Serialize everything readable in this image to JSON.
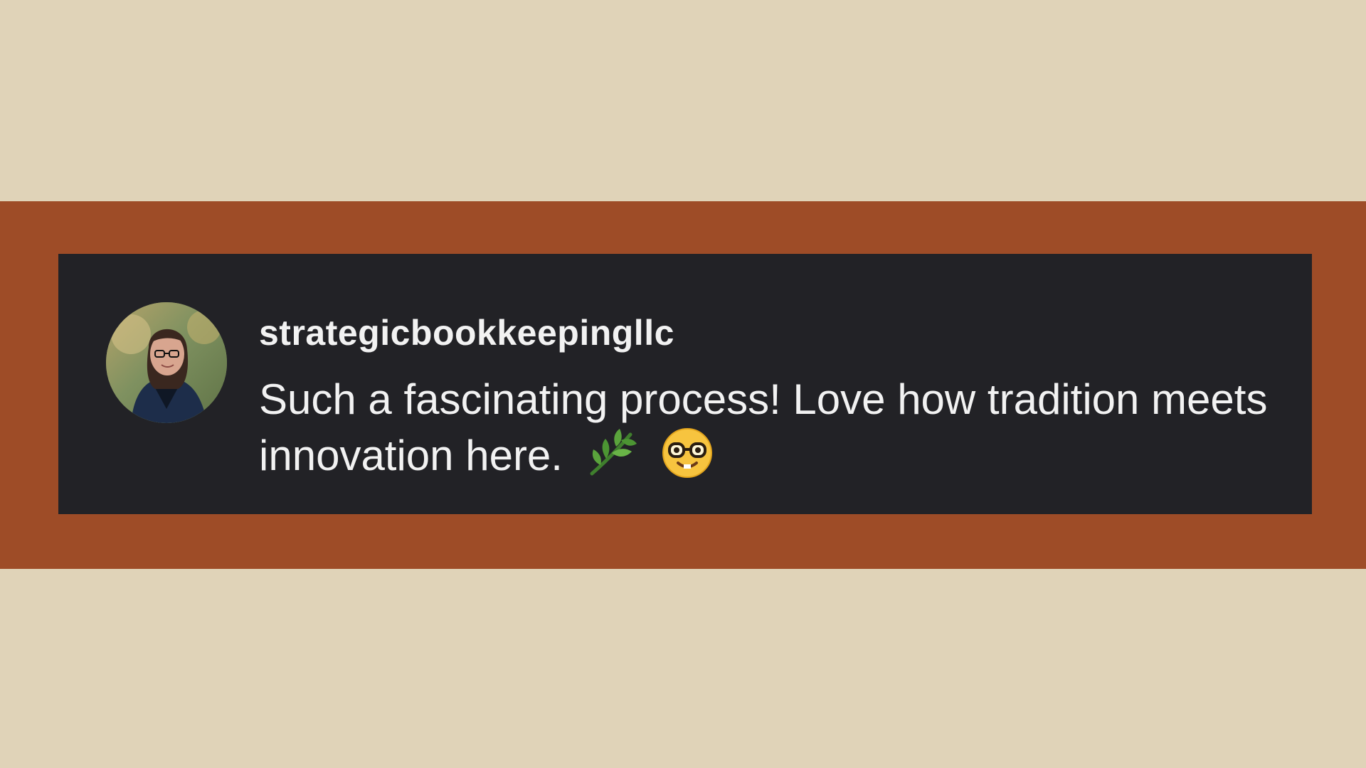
{
  "comment": {
    "username": "strategicbookkeepingllc",
    "text": "Such a fascinating process! Love how tradition meets innovation here.",
    "emojis": [
      "herb-icon",
      "nerd-face-icon"
    ]
  },
  "colors": {
    "background": "#e0d3b8",
    "band": "#9e4c27",
    "card": "#222226",
    "text": "#f2f2f2"
  }
}
